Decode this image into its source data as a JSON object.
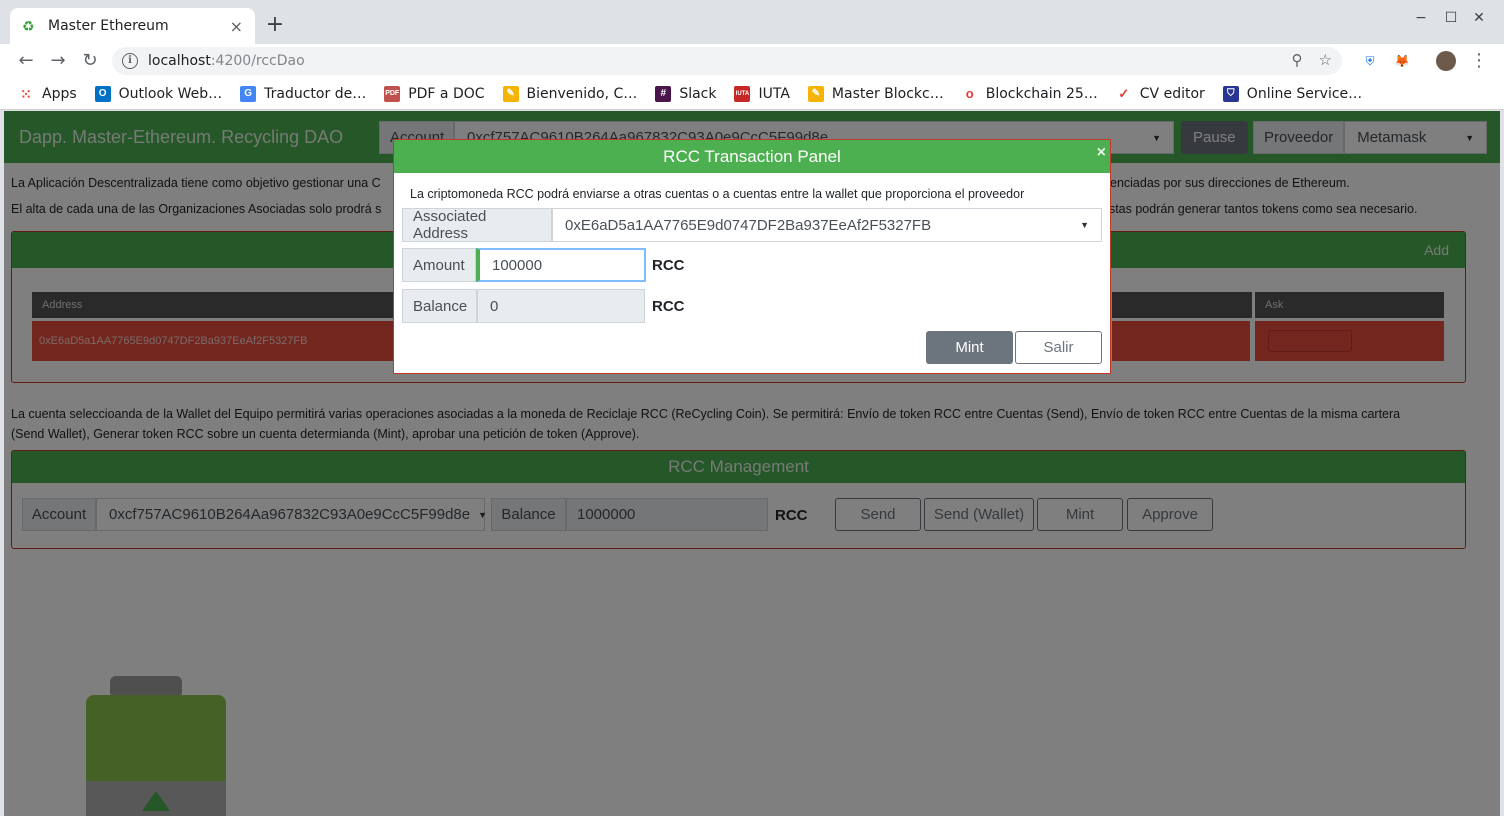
{
  "browser": {
    "tab_title": "Master Ethereum",
    "url_host": "localhost",
    "url_path": ":4200/rccDao",
    "bookmarks": [
      "Apps",
      "Outlook Web…",
      "Traductor de…",
      "PDF a DOC",
      "Bienvenido, C…",
      "Slack",
      "IUTA",
      "Master Blockc…",
      "Blockchain 25…",
      "CV editor",
      "Online Service…"
    ]
  },
  "app": {
    "brand": "Dapp. Master-Ethereum. Recycling DAO",
    "account_label": "Account",
    "account_value": "0xcf757AC9610B264Aa967832C93A0e9CcC5F99d8e",
    "pause_label": "Pause",
    "proveedor_label": "Proveedor",
    "proveedor_value": "Metamask"
  },
  "intro": {
    "line1_left": "La Aplicación Descentralizada tiene como objetivo gestionar una C",
    "line1_right": "enciadas por sus direcciones de Ethereum.",
    "line2_left": "El alta de cada una de las Organizaciones Asociadas solo prodrá s",
    "line2_right": "estas podrán generar tantos tokens como sea necesario."
  },
  "orgs": {
    "add_label": "Add",
    "col_address": "Address",
    "col_ask": "Ask",
    "row_address": "0xE6aD5a1AA7765E9d0747DF2Ba937EeAf2F5327FB"
  },
  "wallet_text": {
    "line1": "La cuenta seleccioanda de la Wallet del Equipo permitirá varias operaciones asociadas a la moneda de Reciclaje RCC (ReCycling Coin). Se permitirá: Envío de token RCC entre Cuentas (Send), Envío de token RCC entre Cuentas de la misma cartera",
    "line2": "(Send Wallet), Generar token RCC sobre un cuenta determianda (Mint), aprobar una petición de token (Approve)."
  },
  "mgmt": {
    "title": "RCC Management",
    "account_label": "Account",
    "account_value": "0xcf757AC9610B264Aa967832C93A0e9CcC5F99d8e",
    "balance_label": "Balance",
    "balance_value": "1000000",
    "unit": "RCC",
    "btn_send": "Send",
    "btn_send_wallet": "Send (Wallet)",
    "btn_mint": "Mint",
    "btn_approve": "Approve"
  },
  "modal": {
    "title": "RCC Transaction Panel",
    "close": "×",
    "description": "La criptomoneda RCC podrá enviarse a otras cuentas o a cuentas entre la wallet que proporciona el proveedor",
    "assoc_label": "Associated Address",
    "assoc_value": "0xE6aD5a1AA7765E9d0747DF2Ba937EeAf2F5327FB",
    "amount_label": "Amount",
    "amount_value": "100000",
    "balance_label": "Balance",
    "balance_value": "0",
    "unit": "RCC",
    "btn_mint": "Mint",
    "btn_salir": "Salir"
  },
  "colors": {
    "accent_green": "#4caf50",
    "danger_red": "#e74c3c",
    "secondary": "#6c757d"
  }
}
